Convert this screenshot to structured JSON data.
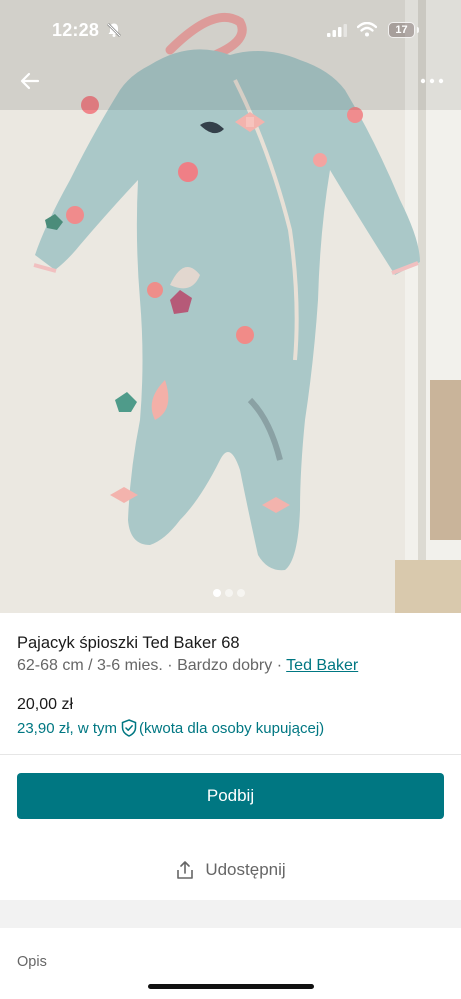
{
  "status_bar": {
    "time": "12:28",
    "battery": "17"
  },
  "gallery": {
    "page_count": 3,
    "active_index": 0
  },
  "listing": {
    "title": "Pajacyk śpioszki Ted Baker 68",
    "size": "62-68 cm / 3-6 mies.",
    "separator": "·",
    "condition": "Bardzo dobry",
    "brand": "Ted Baker",
    "price": "20,00 zł",
    "total_price": "23,90 zł, w tym",
    "buyer_protection": "(kwota dla osoby kupującej)"
  },
  "actions": {
    "bump_label": "Podbij",
    "share_label": "Udostępnij"
  },
  "section": {
    "description_label": "Opis"
  },
  "colors": {
    "accent": "#007782",
    "garment": "#aac8c8",
    "bow": "#f3b3ad"
  },
  "icons": [
    "back-arrow-icon",
    "more-icon",
    "bell-muted-icon",
    "signal-icon",
    "wifi-icon",
    "battery-icon",
    "shield-check-icon",
    "share-icon"
  ]
}
